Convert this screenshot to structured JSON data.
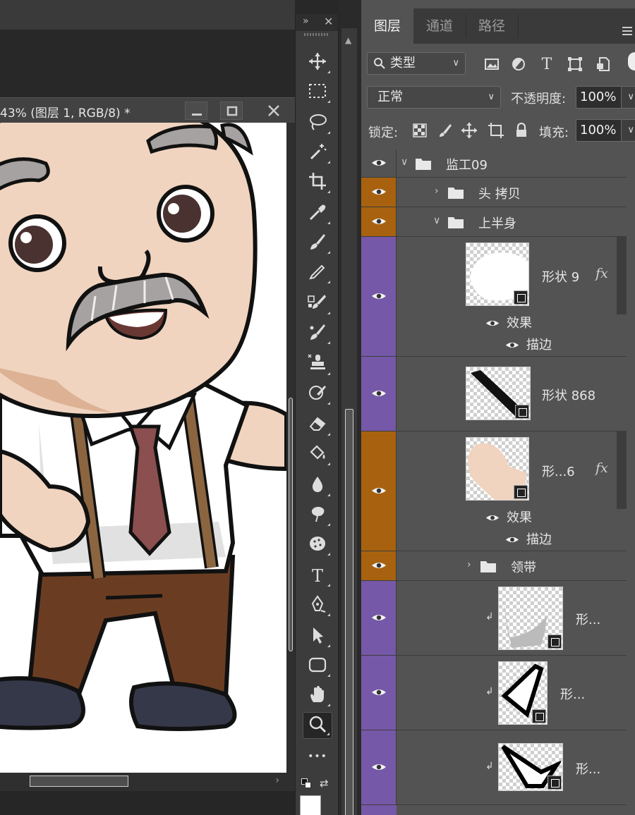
{
  "document": {
    "title": "43% (图层 1, RGB/8) *"
  },
  "toolbar": {
    "collapse": "»",
    "close": "✕",
    "tools": [
      {
        "name": "move-tool",
        "icon": "move-icon"
      },
      {
        "name": "marquee-tool",
        "icon": "rect-marquee-icon"
      },
      {
        "name": "lasso-tool",
        "icon": "lasso-icon"
      },
      {
        "name": "magic-wand-tool",
        "icon": "magic-wand-icon"
      },
      {
        "name": "crop-tool",
        "icon": "crop-icon"
      },
      {
        "name": "eyedropper-tool",
        "icon": "eyedropper-icon"
      },
      {
        "name": "healing-brush-tool",
        "icon": "brush-icon"
      },
      {
        "name": "pencil-tool",
        "icon": "pencil-icon"
      },
      {
        "name": "color-replace-tool",
        "icon": "color-replace-icon"
      },
      {
        "name": "mixer-brush-tool",
        "icon": "mixer-brush-icon"
      },
      {
        "name": "clone-stamp-tool",
        "icon": "stamp-icon"
      },
      {
        "name": "history-brush-tool",
        "icon": "history-brush-icon"
      },
      {
        "name": "eraser-tool",
        "icon": "eraser-icon"
      },
      {
        "name": "paint-bucket-tool",
        "icon": "bucket-icon"
      },
      {
        "name": "blur-tool",
        "icon": "drop-icon"
      },
      {
        "name": "smudge-tool",
        "icon": "smudge-icon"
      },
      {
        "name": "sponge-tool",
        "icon": "sponge-icon"
      },
      {
        "name": "type-tool",
        "icon": "type-icon",
        "glyph": "T"
      },
      {
        "name": "pen-tool",
        "icon": "pen-icon"
      },
      {
        "name": "path-select-tool",
        "icon": "arrow-icon"
      },
      {
        "name": "shape-tool",
        "icon": "rounded-rect-icon"
      },
      {
        "name": "hand-tool",
        "icon": "hand-icon"
      },
      {
        "name": "zoom-tool",
        "icon": "zoom-icon"
      },
      {
        "name": "more-tools",
        "icon": "ellipsis-icon",
        "glyph": "•••"
      }
    ]
  },
  "panel": {
    "tabs": [
      {
        "label": "图层",
        "active": true
      },
      {
        "label": "通道",
        "active": false
      },
      {
        "label": "路径",
        "active": false
      }
    ],
    "filter": {
      "label": "类型"
    },
    "blend_mode": "正常",
    "opacity_label": "不透明度:",
    "opacity_value": "100%",
    "lock_label": "锁定:",
    "fill_label": "填充:",
    "fill_value": "100%"
  },
  "layers": {
    "group_main": {
      "name": "监工09",
      "color": "#535353"
    },
    "head_copy": {
      "name": "头 拷贝",
      "color": "#a8620f"
    },
    "upper_body": {
      "name": "上半身",
      "color": "#a8620f"
    },
    "shape9": {
      "name": "形状 9",
      "fx": "fx",
      "color": "#7658a8"
    },
    "shape9_effects": "效果",
    "shape9_stroke": "描边",
    "shape868": {
      "name": "形状 868",
      "color": "#7658a8"
    },
    "shape6": {
      "name": "形...6",
      "fx": "fx",
      "color": "#a8620f"
    },
    "shape6_effects": "效果",
    "shape6_stroke": "描边",
    "tie": {
      "name": "领带",
      "color": "#a8620f"
    },
    "clip1": {
      "name": "形...",
      "color": "#7658a8"
    },
    "clip2": {
      "name": "形...",
      "color": "#7658a8"
    },
    "clip3": {
      "name": "形...",
      "color": "#7658a8"
    }
  }
}
